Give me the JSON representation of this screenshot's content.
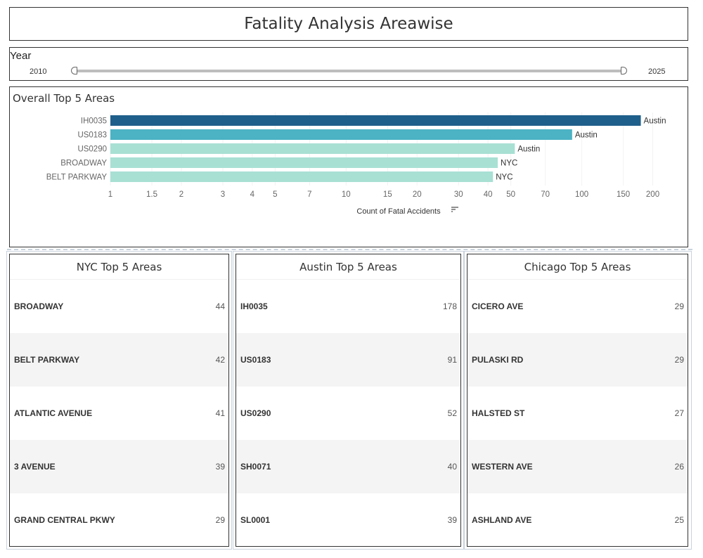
{
  "page_title": "Fatality Analysis Areawise",
  "year_filter": {
    "label": "Year",
    "min": "2010",
    "max": "2025",
    "selected_range": [
      2010,
      2025
    ]
  },
  "overall_chart": {
    "title": "Overall Top 5 Areas",
    "xlabel": "Count of Fatal Accidents",
    "sort_icon": "sort-descending-icon"
  },
  "chart_data": {
    "type": "bar",
    "orientation": "horizontal",
    "title": "Overall Top 5 Areas",
    "xlabel": "Count of Fatal Accidents",
    "ylabel": "",
    "xscale": "log",
    "xlim": [
      1,
      250
    ],
    "categories": [
      "IH0035",
      "US0183",
      "US0290",
      "BROADWAY",
      "BELT PARKWAY"
    ],
    "values": [
      178,
      91,
      52,
      44,
      42
    ],
    "labels": [
      "Austin",
      "Austin",
      "Austin",
      "NYC",
      "NYC"
    ],
    "colors": [
      "#1f5f8b",
      "#4bb3c4",
      "#a8e0d4",
      "#a8e0d4",
      "#a8e0d4"
    ],
    "xticks": [
      1,
      1.5,
      2,
      3,
      4,
      5,
      7,
      10,
      15,
      20,
      30,
      40,
      50,
      70,
      100,
      150,
      200
    ],
    "xtick_labels": [
      "1",
      "1.5",
      "2",
      "3",
      "4",
      "5",
      "7",
      "10",
      "15",
      "20",
      "30",
      "40",
      "50",
      "70",
      "100",
      "150",
      "200"
    ],
    "grid": true
  },
  "tables": {
    "nyc": {
      "title": "NYC Top 5 Areas",
      "rows": [
        {
          "area": "BROADWAY",
          "count": "44"
        },
        {
          "area": "BELT PARKWAY",
          "count": "42"
        },
        {
          "area": "ATLANTIC AVENUE",
          "count": "41"
        },
        {
          "area": "3 AVENUE",
          "count": "39"
        },
        {
          "area": "GRAND CENTRAL PKWY",
          "count": "29"
        }
      ]
    },
    "austin": {
      "title": "Austin Top 5 Areas",
      "rows": [
        {
          "area": "IH0035",
          "count": "178"
        },
        {
          "area": "US0183",
          "count": "91"
        },
        {
          "area": "US0290",
          "count": "52"
        },
        {
          "area": "SH0071",
          "count": "40"
        },
        {
          "area": "SL0001",
          "count": "39"
        }
      ]
    },
    "chicago": {
      "title": "Chicago Top 5 Areas",
      "rows": [
        {
          "area": "CICERO AVE",
          "count": "29"
        },
        {
          "area": "PULASKI RD",
          "count": "29"
        },
        {
          "area": "HALSTED ST",
          "count": "27"
        },
        {
          "area": "WESTERN AVE",
          "count": "26"
        },
        {
          "area": "ASHLAND AVE",
          "count": "25"
        }
      ]
    }
  }
}
